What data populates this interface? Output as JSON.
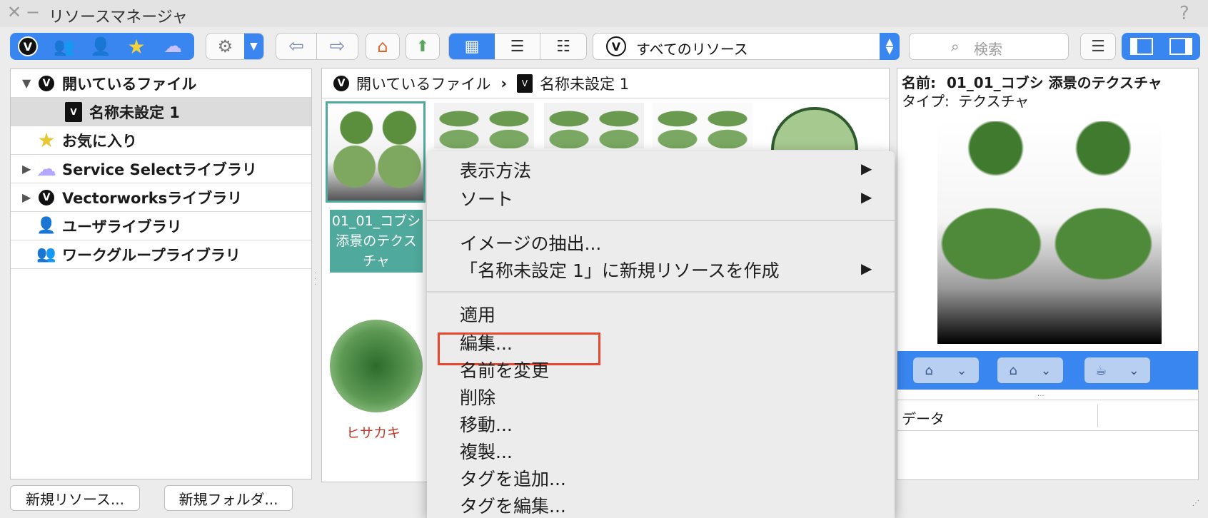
{
  "window": {
    "title": "リソースマネージャ",
    "help": "?"
  },
  "toolbar": {
    "resource_select_label": "すべてのリソース",
    "search_placeholder": "検索"
  },
  "left_panel": {
    "items": [
      {
        "label": "開いているファイル",
        "expanded": true,
        "icon": "vectorworks-logo-icon"
      },
      {
        "label": "名称未設定 1",
        "selected": true,
        "icon": "document-icon"
      },
      {
        "label": "お気に入り",
        "icon": "star-icon"
      },
      {
        "label": "Service Selectライブラリ",
        "icon": "cloud-icon"
      },
      {
        "label": "Vectorworksライブラリ",
        "icon": "vectorworks-logo-icon"
      },
      {
        "label": "ユーザライブラリ",
        "icon": "user-icon"
      },
      {
        "label": "ワークグループライブラリ",
        "icon": "group-icon"
      }
    ]
  },
  "bottom_buttons": {
    "new_resource": "新規リソース...",
    "new_folder": "新規フォルダ..."
  },
  "center_panel": {
    "breadcrumb": {
      "root": "開いているファイル",
      "separator": "›",
      "current": "名称未設定 1"
    },
    "selected_caption": "01_01_コブシ 添景のテクスチャ",
    "plan_symbol_label": "ヒサカキ"
  },
  "right_panel": {
    "name_label": "名前:",
    "name_value": "01_01_コブシ 添景のテクスチャ",
    "type_label": "タイプ:",
    "type_value": "テクスチャ",
    "data_header": "データ"
  },
  "context_menu": {
    "items": [
      {
        "label": "表示方法",
        "submenu": true
      },
      {
        "label": "ソート",
        "submenu": true
      },
      {
        "label": "イメージの抽出..."
      },
      {
        "label": "「名称未設定 1」に新規リソースを作成",
        "submenu": true
      },
      {
        "label": "適用"
      },
      {
        "label": "編集...",
        "highlighted": true
      },
      {
        "label": "名前を変更"
      },
      {
        "label": "削除"
      },
      {
        "label": "移動..."
      },
      {
        "label": "複製..."
      },
      {
        "label": "タグを追加..."
      },
      {
        "label": "タグを編集..."
      }
    ],
    "arrow": "▶"
  },
  "colors": {
    "accent_blue": "#3a86f0",
    "selection_teal": "#4fa99c",
    "highlight_red": "#e8472f",
    "symbol_label_red": "#c0392b"
  }
}
